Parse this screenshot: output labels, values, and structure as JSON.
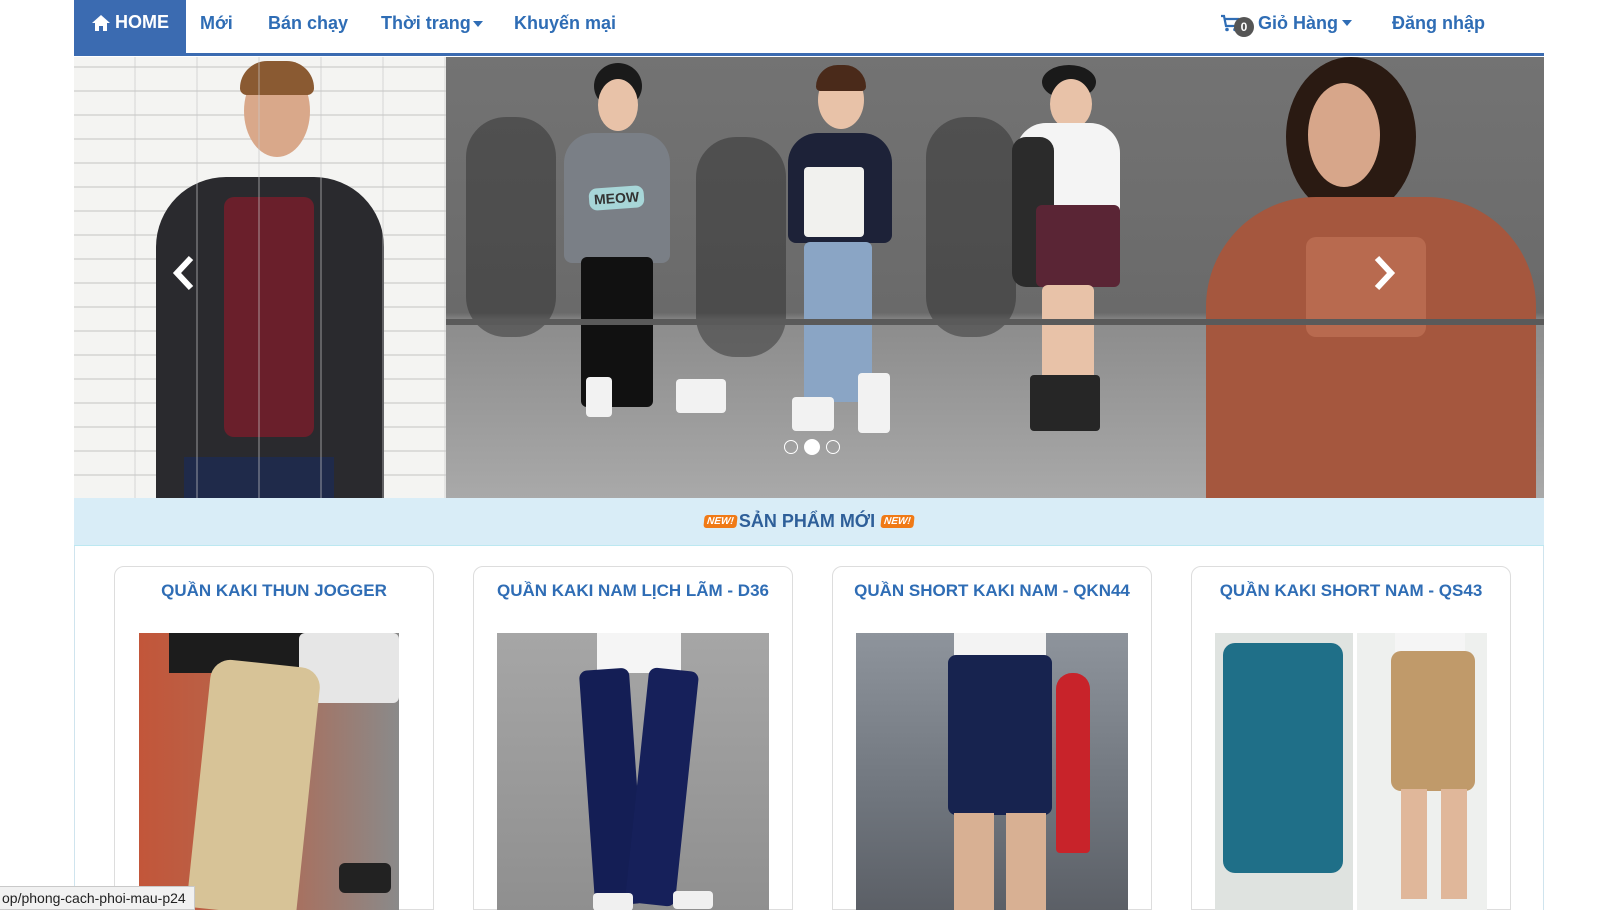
{
  "nav": {
    "home_label": "HOME",
    "items": [
      {
        "label": "Mới"
      },
      {
        "label": "Bán chạy"
      },
      {
        "label": "Thời trang"
      },
      {
        "label": "Khuyến mại"
      }
    ],
    "cart_count": "0",
    "cart_label": "Giỏ Hàng",
    "login_label": "Đăng nhập"
  },
  "carousel": {
    "slide_count": 3,
    "active_slide": 2,
    "prev_icon": "chevron-left-icon",
    "next_icon": "chevron-right-icon",
    "shirt_text": "MEOW"
  },
  "section": {
    "badge": "NEW!",
    "title": "SẢN PHẨM MỚI"
  },
  "products": [
    {
      "name": "QUẦN KAKI THUN JOGGER"
    },
    {
      "name": "QUẦN KAKI NAM LỊCH LÃM - D36"
    },
    {
      "name": "QUẦN SHORT KAKI NAM - QKN44"
    },
    {
      "name": "QUẦN KAKI SHORT NAM - QS43"
    }
  ],
  "status_url": "op/phong-cach-phoi-mau-p24",
  "colors": {
    "brand": "#3b6bb1",
    "link": "#2f6db5",
    "section_bg": "#d9edf7",
    "new_badge": "#f07a16"
  }
}
